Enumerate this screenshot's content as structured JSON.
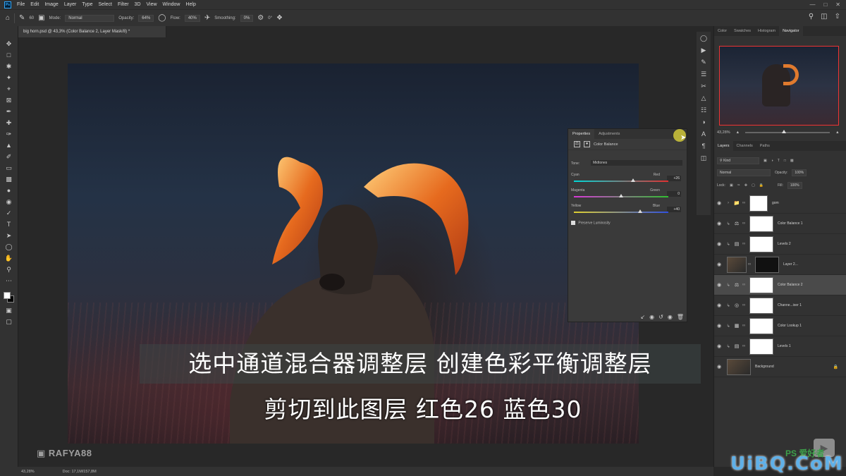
{
  "menubar": {
    "logo": "Ps",
    "items": [
      "File",
      "Edit",
      "Image",
      "Layer",
      "Type",
      "Select",
      "Filter",
      "3D",
      "View",
      "Window",
      "Help"
    ]
  },
  "options": {
    "mode_label": "Mode:",
    "mode_value": "Normal",
    "opacity_label": "Opacity:",
    "opacity_value": "64%",
    "flow_label": "Flow:",
    "flow_value": "40%",
    "smoothing_label": "Smoothing:",
    "smoothing_value": "0%",
    "angle_value": "0°",
    "brush_size": "60"
  },
  "document": {
    "tab_title": "big horn.psd @ 43,3% (Color Balance 2, Layer Mask/8) *"
  },
  "subtitles": {
    "line1": "选中通道混合器调整层 创建色彩平衡调整层",
    "line2": "剪切到此图层 红色26 蓝色30",
    "handle": "RAFYA88"
  },
  "properties": {
    "tab_active": "Properties",
    "tab_other": "Adjustments",
    "title": "Color Balance",
    "tone_label": "Tone:",
    "tone_value": "Midtones",
    "sliders": [
      {
        "left": "Cyan",
        "right": "Red",
        "value": "+26",
        "level": 26
      },
      {
        "left": "Magenta",
        "right": "Green",
        "value": "0",
        "level": 0
      },
      {
        "left": "Yellow",
        "right": "Blue",
        "value": "+40",
        "level": 40
      }
    ],
    "preserve_label": "Preserve Luminosity"
  },
  "right_panel": {
    "tabs": [
      "Color",
      "Swatches",
      "Histogram",
      "Navigator"
    ],
    "active_tab": "Navigator",
    "zoom": "43,28%",
    "layer_tabs": [
      "Layers",
      "Channels",
      "Paths"
    ],
    "kind_label": "Kind",
    "blend_mode": "Normal",
    "opacity_label": "Opacity:",
    "opacity_value": "100%",
    "lock_label": "Lock:",
    "fill_label": "Fill:",
    "fill_value": "100%",
    "layers": [
      {
        "name": "gom",
        "type": "group"
      },
      {
        "name": "Color Balance 1",
        "type": "adjustment"
      },
      {
        "name": "Levels 2",
        "type": "adjustment"
      },
      {
        "name": "Layer 2...",
        "type": "pixel"
      },
      {
        "name": "Color Balance 2",
        "type": "adjustment",
        "selected": true
      },
      {
        "name": "Channe...ixer 1",
        "type": "adjustment"
      },
      {
        "name": "Color Lookup 1",
        "type": "adjustment"
      },
      {
        "name": "Levels 1",
        "type": "adjustment"
      },
      {
        "name": "Background",
        "type": "background"
      }
    ]
  },
  "status": {
    "zoom": "43,28%",
    "doc": "Doc: 17,1M/157,8M"
  },
  "watermark": {
    "site": "UiBQ.CoM",
    "ps_tag": "PS 爱好者"
  }
}
